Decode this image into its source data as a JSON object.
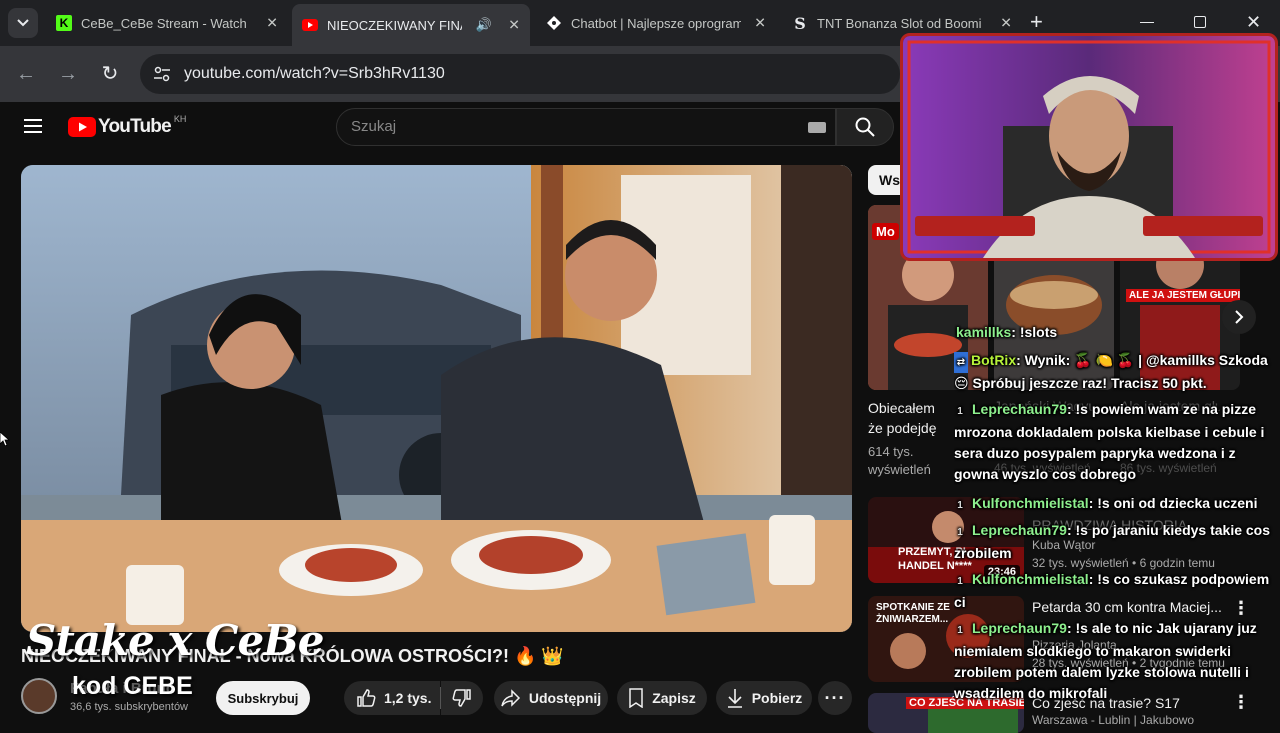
{
  "browser": {
    "tabs": [
      {
        "title": "CeBe_CeBe Stream - Watch Li",
        "favicon": "kick-icon"
      },
      {
        "title": "NIEOCZEKIWANY FINAŁ...",
        "favicon": "youtube-icon",
        "audio": true
      },
      {
        "title": "Chatbot | Najlepsze oprogram",
        "favicon": "chatbot-icon"
      },
      {
        "title": "TNT Bonanza Slot od Booming",
        "favicon": "s-icon"
      }
    ],
    "new_tab": "+",
    "url": "youtube.com/watch?v=Srb3hRv1130"
  },
  "youtube": {
    "logo_text": "YouTube",
    "region": "KH",
    "search_placeholder": "Szukaj",
    "video": {
      "title": "NIEOCZEKIWANY FINAŁ - Nowa KRÓLOWA OSTROŚCI?! 🔥 👑",
      "channel": "Fabuła i Bruno",
      "subscribers": "36,6 tys. subskrybentów",
      "subscribe_label": "Subskrybuj",
      "likes": "1,2 tys.",
      "share_label": "Udostępnij",
      "save_label": "Zapisz",
      "download_label": "Pobierz"
    },
    "chip": "Ws",
    "shorts": [
      {
        "title": "Obiecałem że podejdę",
        "views": "614 tys. wyświetleń"
      },
      {
        "title": "Japoński Wagyu",
        "views": "46 tys. wyświetleń"
      },
      {
        "title": "Ale ja jestem głupi jedna",
        "views": "86 tys. wyświetleń",
        "overlay": "ALE JA JESTEM GŁUPI"
      }
    ],
    "recommendations": [
      {
        "title": "PRAWDZIWA HISTORIA",
        "channel": "Kuba Wątor",
        "meta": "32 tys. wyświetleń • 6 godzin temu",
        "duration": "23:46",
        "thumb_text": "PRZEMYT, PI... HANDEL N****"
      },
      {
        "title": "Petarda 30 cm kontra Maciej...",
        "channel": "Pizzeria Jolanta",
        "meta": "28 tys. wyświetleń • 2 tygodnie temu",
        "thumb_text": "SPOTKANIE ZE ŻNIWIARZEM..."
      },
      {
        "title": "Co zjeść na trasie? S17",
        "channel": "",
        "meta": "Warszawa - Lublin | Jakubowo",
        "thumb_text": "CO ZJEŚĆ NA TRASIE?"
      }
    ]
  },
  "overlay": {
    "brand": "Stake x CeBe",
    "code": "kod CEBE"
  },
  "chat": [
    {
      "user": "kamillks",
      "text": ": !slots",
      "badge": ""
    },
    {
      "user": "BotRix",
      "text": ": Wynik: 🍒 🍋 🍒 | @kamillks Szkoda 😔 Spróbuj jeszcze raz! Tracisz 50 pkt.",
      "badge": "bot"
    },
    {
      "user": "Leprechaun79",
      "text": ": !s powiem wam ze na pizze mrozona dokladalem polska kielbase i cebule i sera duzo posypalem papryka wedzona i z gowna wyszlo cos dobrego",
      "badge": "1"
    },
    {
      "user": "Kulfonchmielistal",
      "text": ": !s oni od dziecka uczeni",
      "badge": "1"
    },
    {
      "user": "Leprechaun79",
      "text": ": !s po jaraniu kiedys takie cos zrobilem",
      "badge": "1"
    },
    {
      "user": "Kulfonchmielistal",
      "text": ": !s co szukasz podpowiem ci",
      "badge": "1"
    },
    {
      "user": "Leprechaun79",
      "text": ": !s ale to nic Jak ujarany juz niemialem slodkiego to makaron swiderki zrobilem potem dalem lyzke stolowa nutelli i wsadzilem do mikrofali",
      "badge": "1"
    }
  ]
}
